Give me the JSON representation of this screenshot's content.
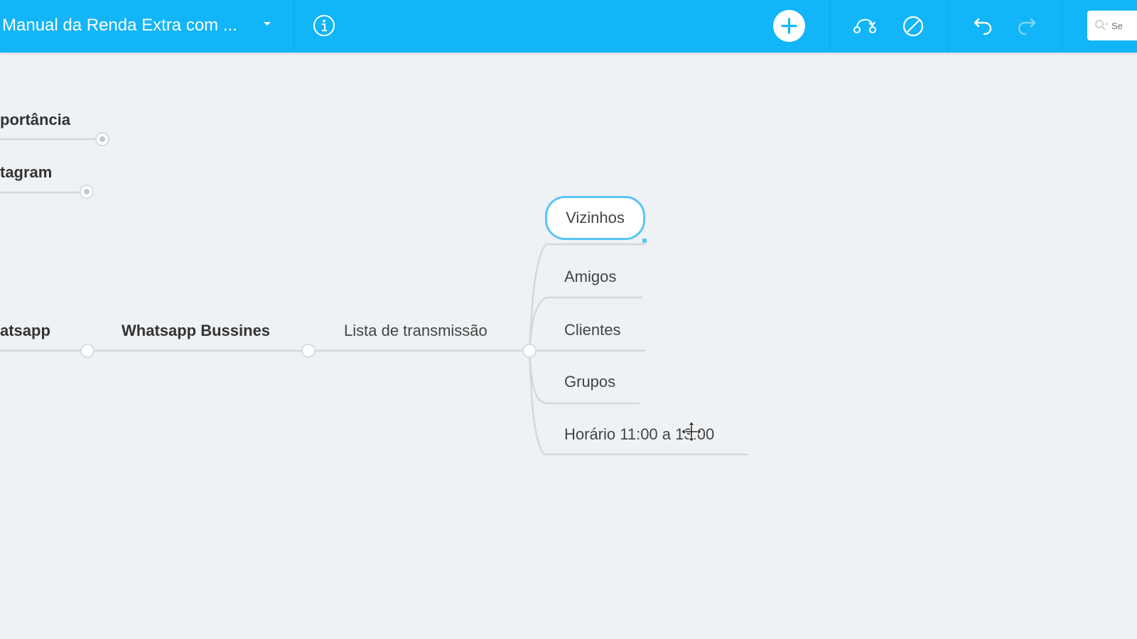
{
  "toolbar": {
    "document_title": "Manual da Renda Extra com ...",
    "icons": {
      "dropdown": "caret-down-icon",
      "info": "info-icon",
      "add": "plus-icon",
      "connect": "relation-icon",
      "disable": "slash-circle-icon",
      "undo": "undo-icon",
      "redo": "redo-icon",
      "search": "search-icon"
    },
    "search": {
      "placeholder": "Se"
    }
  },
  "mindmap": {
    "nodes": {
      "importancia": "portância",
      "instagram": "tagram",
      "whatsapp": "atsapp",
      "whatsapp_business": "Whatsapp Bussines",
      "lista": "Lista de transmissão",
      "children": [
        "Vizinhos",
        "Amigos",
        "Clientes",
        "Grupos",
        "Horário 11:00 a 13:00"
      ]
    },
    "selected_node": "Vizinhos"
  },
  "colors": {
    "toolbar": "#12b5f7",
    "canvas": "#eff2f5",
    "selection": "#58c5f4",
    "branch_line": "#d3d8dc"
  }
}
